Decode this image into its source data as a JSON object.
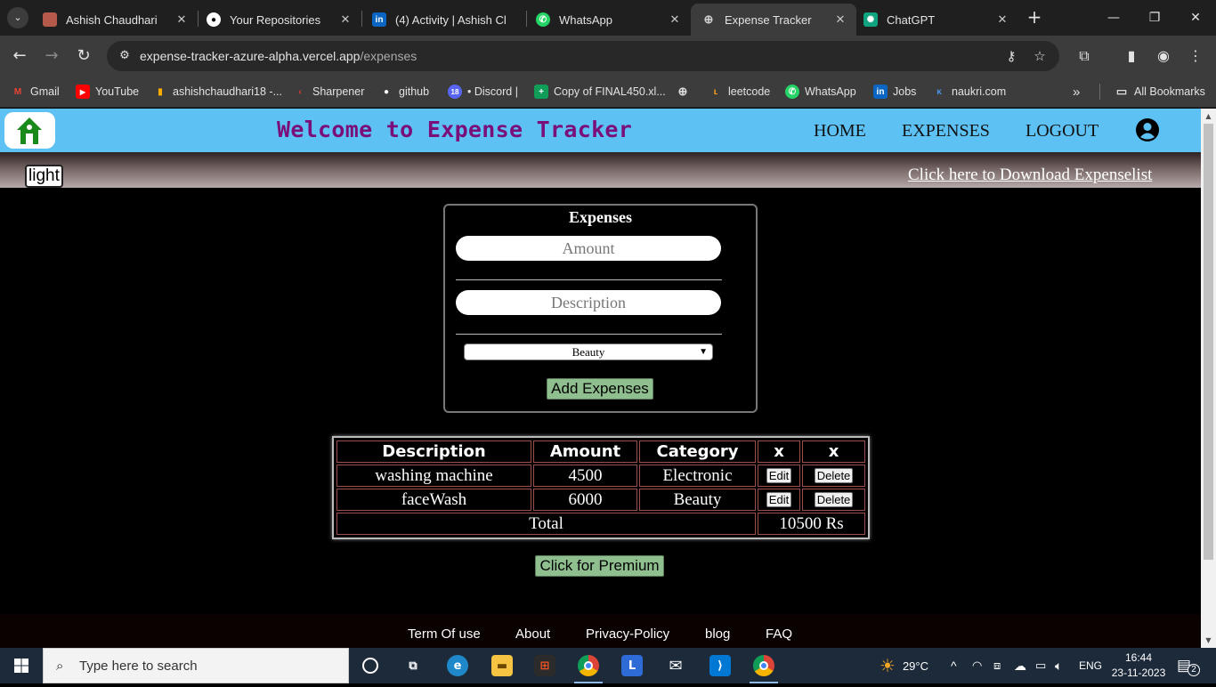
{
  "browser": {
    "tabs": [
      {
        "title": "Ashish Chaudhari",
        "icon": "profile-photo-icon",
        "close": "✕"
      },
      {
        "title": "Your Repositories",
        "icon": "github-icon",
        "close": "✕"
      },
      {
        "title": "(4) Activity | Ashish Cl",
        "icon": "linkedin-icon",
        "close": ""
      },
      {
        "title": "WhatsApp",
        "icon": "whatsapp-icon",
        "close": "✕"
      },
      {
        "title": "Expense Tracker",
        "icon": "globe-icon",
        "close": "✕",
        "active": true
      },
      {
        "title": "ChatGPT",
        "icon": "chatgpt-icon",
        "close": "✕"
      }
    ],
    "new_tab": "+",
    "window_controls": {
      "minimize": "—",
      "restore": "❐",
      "close": "✕"
    },
    "nav": {
      "back": "←",
      "forward": "→",
      "reload": "↻"
    },
    "url_host": "expense-tracker-azure-alpha.vercel.app",
    "url_path": "/expenses",
    "bookmarks": [
      {
        "label": "Gmail",
        "icon": "gmail-icon"
      },
      {
        "label": "YouTube",
        "icon": "youtube-icon"
      },
      {
        "label": "ashishchaudhari18 -...",
        "icon": "analytics-icon"
      },
      {
        "label": "Sharpener",
        "icon": "sharpener-icon"
      },
      {
        "label": "github",
        "icon": "github-icon"
      },
      {
        "label": "• Discord |",
        "icon": "discord-icon"
      },
      {
        "label": "Copy of FINAL450.xl...",
        "icon": "sheets-icon"
      },
      {
        "label": "",
        "icon": "globe-icon"
      },
      {
        "label": "leetcode",
        "icon": "leetcode-icon"
      },
      {
        "label": "WhatsApp",
        "icon": "whatsapp-icon"
      },
      {
        "label": "Jobs",
        "icon": "linkedin-icon"
      },
      {
        "label": "naukri.com",
        "icon": "naukri-icon"
      }
    ],
    "bookmarks_overflow": "»",
    "all_bookmarks": "All Bookmarks",
    "bookmark_icon_colors": {
      "gmail": "#ea4335",
      "youtube": "#ff0000",
      "analytics": "#f9ab00",
      "sharpener": "#e53935",
      "github": "#ffffff",
      "discord": "#5865f2",
      "sheets": "#0f9d58",
      "leetcode": "#ffa116",
      "whatsapp": "#25d366",
      "linkedin": "#0a66c2",
      "naukri": "#4a90e2"
    }
  },
  "site": {
    "title": "Welcome to Expense Tracker",
    "nav_links": [
      "HOME",
      "EXPENSES",
      "LOGOUT"
    ],
    "theme_toggle": "light",
    "download_link": "Click here to Download Expenselist",
    "colors": {
      "nav_bg": "#5ec1f4",
      "title": "#7a0f7a",
      "button_green": "#8fbf8f"
    }
  },
  "form": {
    "heading": "Expenses",
    "amount_placeholder": "Amount",
    "description_placeholder": "Description",
    "category_selected": "Beauty",
    "submit_label": "Add Expenses"
  },
  "table": {
    "headers": [
      "Description",
      "Amount",
      "Category",
      "x",
      "x"
    ],
    "rows": [
      {
        "description": "washing machine",
        "amount": "4500",
        "category": "Electronic",
        "edit": "Edit",
        "delete": "Delete"
      },
      {
        "description": "faceWash",
        "amount": "6000",
        "category": "Beauty",
        "edit": "Edit",
        "delete": "Delete"
      }
    ],
    "total_label": "Total",
    "total_value": "10500 Rs"
  },
  "premium_button": "Click for Premium",
  "footer_links": [
    "Term Of use",
    "About",
    "Privacy-Policy",
    "blog",
    "FAQ"
  ],
  "taskbar": {
    "search_placeholder": "Type here to search",
    "apps": [
      "task-view-icon",
      "widgets-icon",
      "edge-icon",
      "file-explorer-icon",
      "store-icon",
      "chrome-icon",
      "linear-icon",
      "mail-icon",
      "vscode-icon",
      "chrome-icon"
    ],
    "weather": "29°C",
    "language": "ENG",
    "time": "16:44",
    "date": "23-11-2023",
    "notifications": "2"
  }
}
